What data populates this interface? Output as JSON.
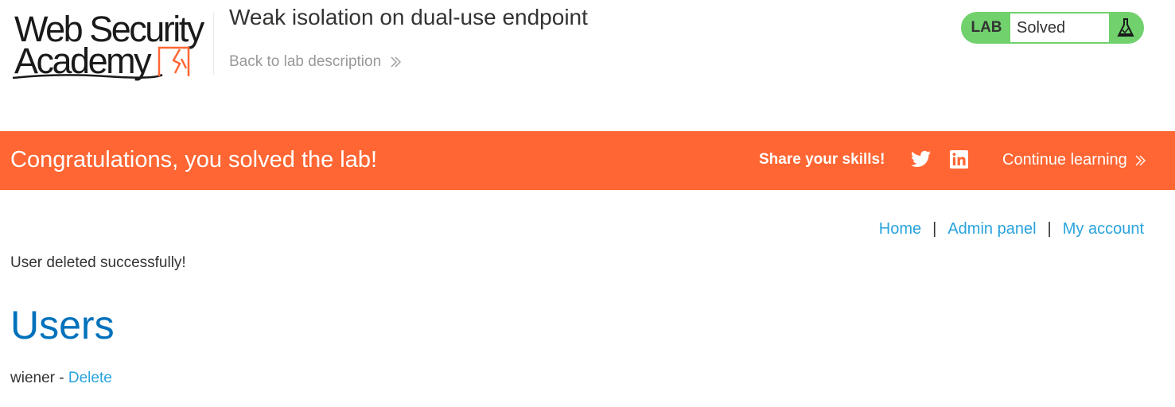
{
  "header": {
    "logo": {
      "line1": "Web Security",
      "line2": "Academy"
    },
    "lab_title": "Weak isolation on dual-use endpoint",
    "back_link": "Back to lab description",
    "lab_status": {
      "label": "LAB",
      "value": "Solved",
      "icon": "flask-icon"
    }
  },
  "banner": {
    "message": "Congratulations, you solved the lab!",
    "share_label": "Share your skills!",
    "social_icons": [
      "twitter-icon",
      "linkedin-icon"
    ],
    "continue_link": "Continue learning",
    "color": "#ff6633"
  },
  "nav": {
    "home": "Home",
    "separator": "|",
    "admin_panel": "Admin panel",
    "my_account": "My account"
  },
  "main": {
    "notice": "User deleted successfully!",
    "heading": "Users",
    "users": [
      {
        "name": "wiener",
        "separator": "-",
        "action": "Delete"
      }
    ]
  },
  "colors": {
    "accent_orange": "#ff6633",
    "status_green": "#70d16d",
    "link_blue": "#29a3dc",
    "heading_blue": "#0071bc",
    "text": "#333332"
  }
}
